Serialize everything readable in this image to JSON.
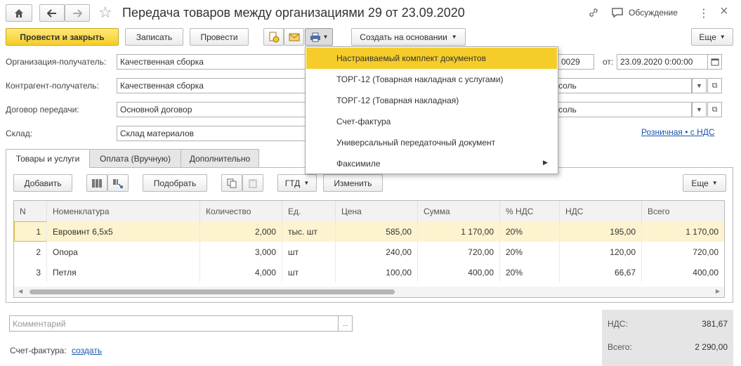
{
  "window": {
    "title": "Передача товаров между организациями 29 от 23.09.2020",
    "discuss": "Обсуждение"
  },
  "toolbar": {
    "post_close": "Провести и закрыть",
    "save": "Записать",
    "post": "Провести",
    "create_basis": "Создать на основании",
    "more": "Еще"
  },
  "form": {
    "org_label": "Организация-получатель:",
    "org_value": "Качественная сборка",
    "number_tail": "0029",
    "date_label": "от:",
    "date_value": "23.09.2020  0:00:00",
    "contr_label": "Контрагент-получатель:",
    "contr_value": "Качественная сборка",
    "contr_tail": "соль",
    "contract_label": "Договор передачи:",
    "contract_value": "Основной договор",
    "contract_tail": "соль",
    "warehouse_label": "Склад:",
    "warehouse_value": "Склад материалов",
    "price_type_link": "Розничная • с НДС"
  },
  "tabs": [
    "Товары и услуги",
    "Оплата (Вручную)",
    "Дополнительно"
  ],
  "table_toolbar": {
    "add": "Добавить",
    "select": "Подобрать",
    "gtd": "ГТД",
    "change": "Изменить",
    "more": "Еще"
  },
  "table": {
    "columns": [
      "N",
      "Номенклатура",
      "Количество",
      "Ед.",
      "Цена",
      "Сумма",
      "% НДС",
      "НДС",
      "Всего"
    ],
    "rows": [
      [
        "1",
        "Евровинт 6,5х5",
        "2,000",
        "тыс. шт",
        "585,00",
        "1 170,00",
        "20%",
        "195,00",
        "1 170,00"
      ],
      [
        "2",
        "Опора",
        "3,000",
        "шт",
        "240,00",
        "720,00",
        "20%",
        "120,00",
        "720,00"
      ],
      [
        "3",
        "Петля",
        "4,000",
        "шт",
        "100,00",
        "400,00",
        "20%",
        "66,67",
        "400,00"
      ]
    ]
  },
  "print_menu": {
    "items": [
      "Настраиваемый комплект документов",
      "ТОРГ-12 (Товарная накладная с услугами)",
      "ТОРГ-12 (Товарная накладная)",
      "Счет-фактура",
      "Универсальный передаточный документ",
      "Факсимиле"
    ]
  },
  "footer": {
    "comment_placeholder": "Комментарий",
    "invoice_label": "Счет-фактура:",
    "invoice_link": "создать",
    "vat_label": "НДС:",
    "vat_value": "381,67",
    "total_label": "Всего:",
    "total_value": "2 290,00"
  },
  "colors": {
    "accent": "#f5cd2a",
    "selected_row": "#fdf3cf",
    "link": "#1a56b0"
  }
}
